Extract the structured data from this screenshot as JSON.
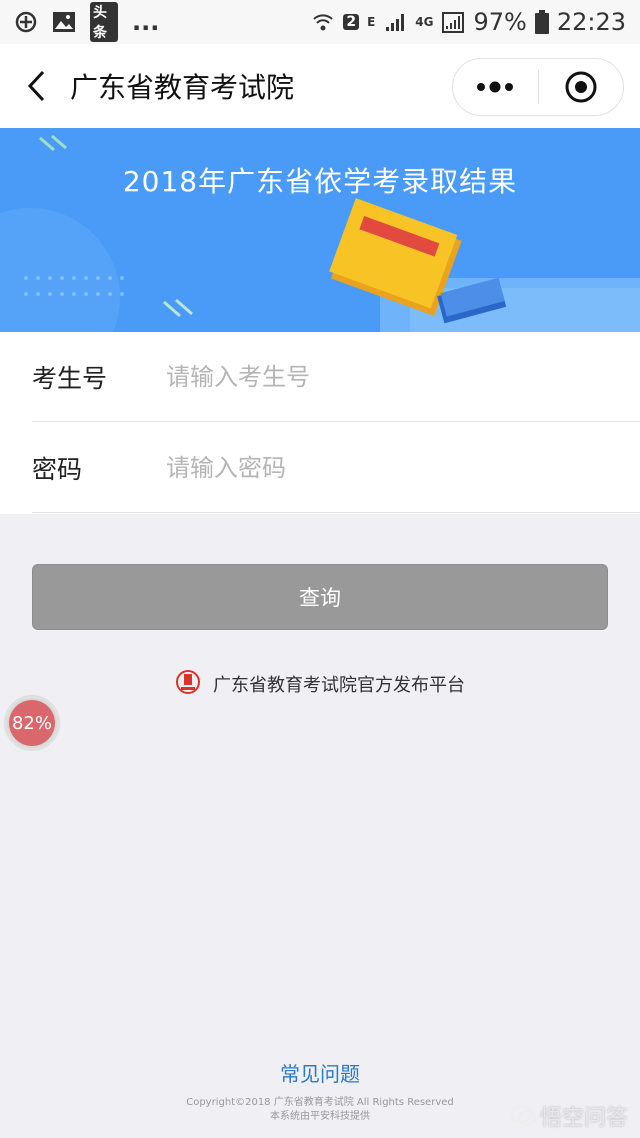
{
  "status_bar": {
    "left_icons": [
      "location-icon",
      "image-icon",
      "toutiao-icon"
    ],
    "toutiao_label": "头条",
    "ellipsis": "...",
    "sim_badge": "2",
    "network_e": "E",
    "network_4g": "4G",
    "battery_percent": "97%",
    "time": "22:23"
  },
  "nav": {
    "title": "广东省教育考试院"
  },
  "banner": {
    "title": "2018年广东省依学考录取结果",
    "colors": {
      "background": "#4a9bf7",
      "book": "#f7c325"
    }
  },
  "form": {
    "exam_id_label": "考生号",
    "exam_id_placeholder": "请输入考生号",
    "password_label": "密码",
    "password_placeholder": "请输入密码"
  },
  "query_button": {
    "label": "查询"
  },
  "official_note": {
    "text": "广东省教育考试院官方发布平台",
    "icon": "exam-authority-logo-icon"
  },
  "float_badge": {
    "value": "82%"
  },
  "footer": {
    "faq_link": "常见问题",
    "copyright_line1": "Copyright©2018 广东省教育考试院 All Rights Reserved",
    "copyright_line2": "本系统由平安科技提供"
  },
  "watermark": {
    "text": "悟空问答"
  }
}
